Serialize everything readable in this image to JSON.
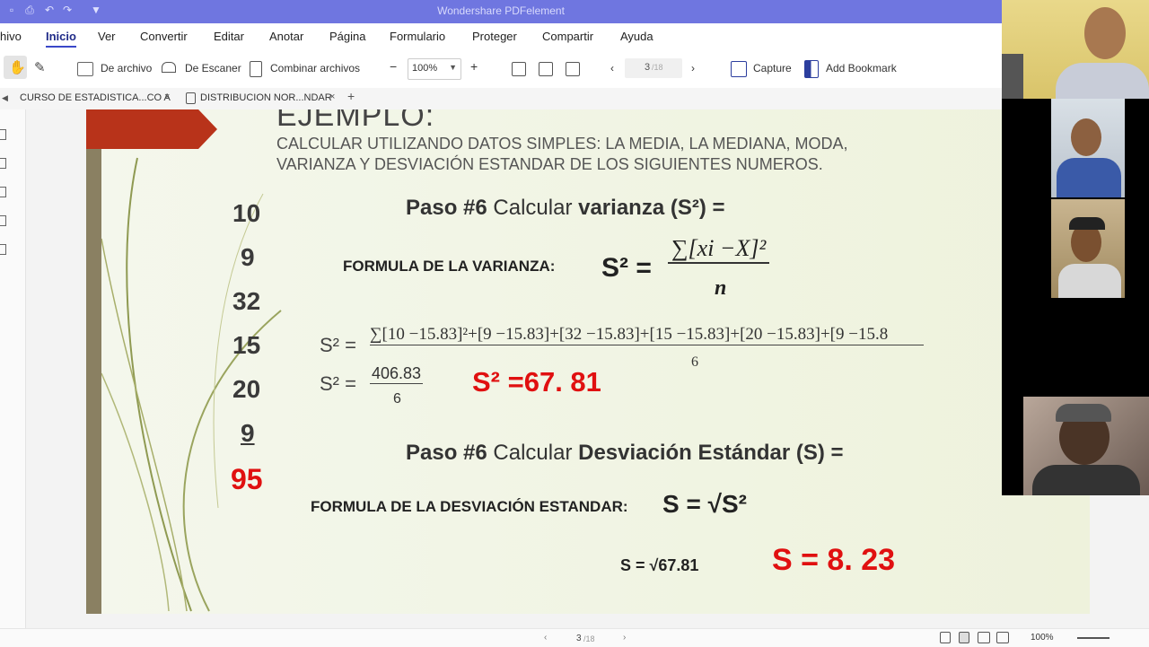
{
  "app": {
    "title": "Wondershare PDFelement"
  },
  "menu": {
    "items": [
      "hivo",
      "Inicio",
      "Ver",
      "Convertir",
      "Editar",
      "Anotar",
      "Página",
      "Formulario",
      "Proteger",
      "Compartir",
      "Ayuda"
    ]
  },
  "toolbar": {
    "de_archivo": "De archivo",
    "de_escaner": "De Escaner",
    "combinar": "Combinar archivos",
    "zoom": "100%",
    "minus": "−",
    "plus": "+",
    "page_current": "3",
    "page_total": "/18",
    "capture": "Capture",
    "add_bookmark": "Add Bookmark"
  },
  "tabs": [
    {
      "label": "CURSO DE ESTADISTICA...CO A"
    },
    {
      "label": "DISTRIBUCION NOR...NDAR"
    }
  ],
  "slide": {
    "heading_partial": "EJEMPLO:",
    "subtitle_line1": "CALCULAR UTILIZANDO DATOS SIMPLES: LA MEDIA, LA MEDIANA, MODA,",
    "subtitle_line2": "VARIANZA Y DESVIACIÓN ESTANDAR DE LOS SIGUIENTES NUMEROS.",
    "numbers": [
      "10",
      "9",
      "32",
      "15",
      "20",
      "9"
    ],
    "total": "95",
    "step_varianza": {
      "a": "Paso #6",
      "b": " Calcular ",
      "c": "varianza (S²) ="
    },
    "formula_var_label": "FORMULA DE LA VARIANZA:",
    "formula_var_lhs": "S² =",
    "formula_var_num": "∑[xi −X]²",
    "formula_var_den": "n",
    "calc_lhs": "S² =",
    "calc_num": "∑[10 −15.83]²+[9 −15.83]+[32 −15.83]+[15 −15.83]+[20 −15.83]+[9 −15.8",
    "calc_den": "6",
    "calc2_lhs": "S² =",
    "calc2_num": "406.83",
    "calc2_den": "6",
    "result_var": "S² =67. 81",
    "step_desv": {
      "a": "Paso #6",
      "b": " Calcular ",
      "c": "Desviación Estándar (S) ="
    },
    "formula_desv_label": "FORMULA DE LA DESVIACIÓN ESTANDAR:",
    "formula_desv": "S = √S²",
    "calc_desv": "S = √67.81",
    "result_desv": "S = 8. 23"
  },
  "status": {
    "page": "3",
    "total": "/18",
    "zoom": "100%"
  },
  "colors": {
    "accent": "#6f76e0",
    "slide_red": "#e01010",
    "bar_red": "#b8331a"
  }
}
